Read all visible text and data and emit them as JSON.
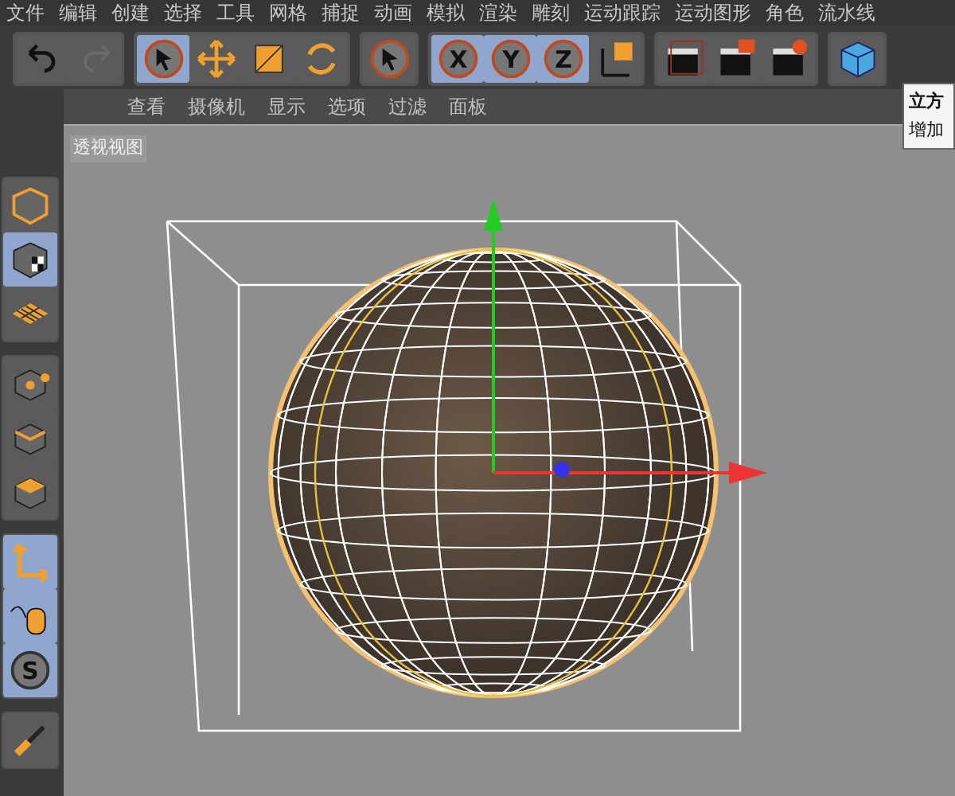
{
  "menu": [
    "文件",
    "编辑",
    "创建",
    "选择",
    "工具",
    "网格",
    "捕捉",
    "动画",
    "模拟",
    "渲染",
    "雕刻",
    "运动跟踪",
    "运动图形",
    "角色",
    "流水线"
  ],
  "toolbar": [
    [
      {
        "kind": "undo",
        "selected": false
      },
      {
        "kind": "redo",
        "selected": false
      }
    ],
    [
      {
        "kind": "select",
        "selected": true
      },
      {
        "kind": "move",
        "selected": false
      },
      {
        "kind": "scale",
        "selected": false
      },
      {
        "kind": "rotate",
        "selected": false
      }
    ],
    [
      {
        "kind": "select",
        "selected": false
      }
    ],
    [
      {
        "kind": "x",
        "label": "X",
        "selected": true
      },
      {
        "kind": "y",
        "label": "Y",
        "selected": true
      },
      {
        "kind": "z",
        "label": "Z",
        "selected": true
      },
      {
        "kind": "coord",
        "selected": false
      }
    ],
    [
      {
        "kind": "render-region",
        "selected": false
      },
      {
        "kind": "render-view",
        "selected": false
      },
      {
        "kind": "render-settings",
        "selected": false
      }
    ],
    [
      {
        "kind": "cube",
        "selected": false
      }
    ]
  ],
  "sidebar": [
    [
      {
        "kind": "model",
        "selected": false
      },
      {
        "kind": "texture",
        "selected": true
      },
      {
        "kind": "workplane",
        "selected": false
      }
    ],
    [
      {
        "kind": "points",
        "selected": false
      },
      {
        "kind": "edges",
        "selected": false
      },
      {
        "kind": "polygons",
        "selected": false
      }
    ],
    [
      {
        "kind": "axis",
        "selected": true
      },
      {
        "kind": "tweak",
        "selected": true
      },
      {
        "kind": "snap",
        "label": "S",
        "selected": true
      }
    ],
    [
      {
        "kind": "brush",
        "selected": false
      }
    ]
  ],
  "viewport": {
    "menu": [
      "查看",
      "摄像机",
      "显示",
      "选项",
      "过滤",
      "面板"
    ],
    "label": "透视视图"
  },
  "tooltip": {
    "title": "立方",
    "text": "增加"
  }
}
